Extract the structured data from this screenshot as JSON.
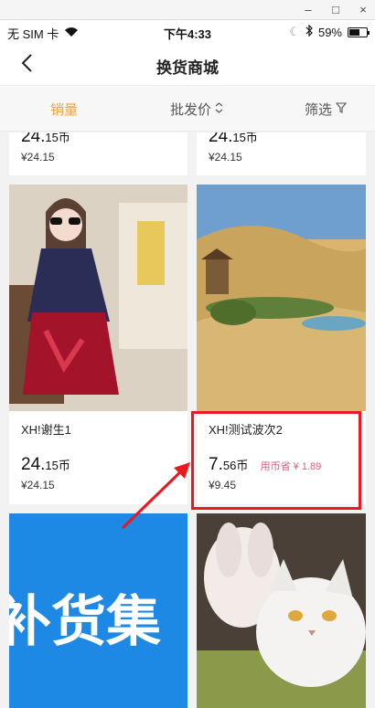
{
  "window": {
    "minimize": "–",
    "maximize": "□",
    "close": "×"
  },
  "status_bar": {
    "carrier": "无 SIM 卡",
    "time": "下午4:33",
    "battery": "59%"
  },
  "nav": {
    "title": "换货商城"
  },
  "filters": {
    "sales": "销量",
    "price": "批发价",
    "filter": "筛选"
  },
  "products": [
    {
      "name": "",
      "price_main": "24.",
      "price_rest": "15币",
      "orig": "¥24.15"
    },
    {
      "name": "",
      "price_main": "24.",
      "price_rest": "15币",
      "orig": "¥24.15"
    },
    {
      "name": "XH!谢生1",
      "price_main": "24.",
      "price_rest": "15币",
      "orig": "¥24.15"
    },
    {
      "name": "XH!测试波次2",
      "price_main": "7.",
      "price_rest": "56币",
      "save": "用币省 ¥ 1.89",
      "orig": "¥9.45"
    }
  ],
  "banner": {
    "text": "补货集"
  },
  "colors": {
    "accent": "#f0a33a",
    "save": "#e25a7a",
    "highlight": "#e8191f"
  }
}
